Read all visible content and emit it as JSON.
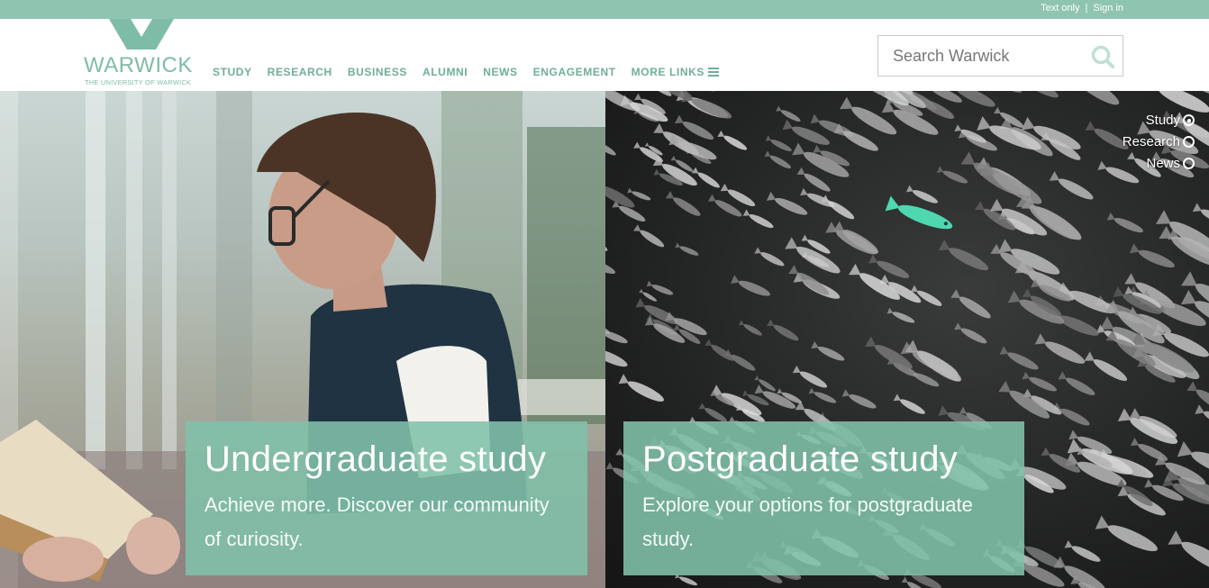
{
  "utility": {
    "text_only": "Text only",
    "separator": "|",
    "sign_in": "Sign in"
  },
  "logo": {
    "name": "WARWICK",
    "subtitle": "THE UNIVERSITY OF WARWICK"
  },
  "nav": {
    "items": [
      "STUDY",
      "RESEARCH",
      "BUSINESS",
      "ALUMNI",
      "NEWS",
      "ENGAGEMENT",
      "MORE LINKS"
    ]
  },
  "search": {
    "placeholder": "Search Warwick",
    "icon": "search-icon"
  },
  "hero": {
    "left": {
      "title": "Undergraduate study",
      "text": "Achieve more. Discover our community of curiosity."
    },
    "right": {
      "title": "Postgraduate study",
      "text": "Explore your options for postgraduate study."
    },
    "slider": {
      "items": [
        "Study",
        "Research",
        "News"
      ],
      "active": "Study"
    }
  },
  "colors": {
    "brand": "#8ec4b0",
    "nav_text": "#6fae98",
    "promo_box": "#81c1aa",
    "highlight_fish": "#4fd7b0"
  }
}
